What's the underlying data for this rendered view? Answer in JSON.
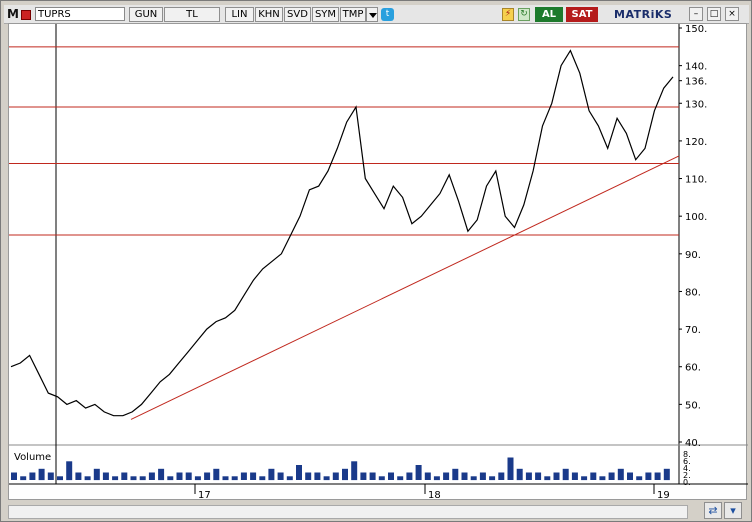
{
  "toolbar": {
    "menu_label": "M",
    "symbol": "TUPRS",
    "buttons": [
      "GUN",
      "TL",
      "LIN",
      "KHN",
      "SVD",
      "SYM",
      "TMP"
    ],
    "buy_label": "AL",
    "sell_label": "SAT",
    "brand": "MATRiKS",
    "window_controls": [
      "–",
      "□",
      "×"
    ]
  },
  "chart": {
    "price_axis_labels": [
      "150.",
      "140.",
      "136.",
      "130.",
      "120.",
      "110.",
      "100.",
      "90.",
      "80.",
      "70.",
      "60.",
      "50.",
      "40."
    ],
    "date_labels": [
      "17",
      "18",
      "19"
    ],
    "volume_label": "Volume",
    "volume_axis_labels": [
      "8.",
      "6.",
      "4.",
      "2.",
      "0."
    ]
  },
  "chart_data": {
    "type": "line",
    "y_range": [
      40,
      150
    ],
    "y_ticks": [
      150,
      140,
      136,
      130,
      120,
      110,
      100,
      90,
      80,
      70,
      60,
      50,
      40
    ],
    "horizontal_levels": [
      145,
      129,
      114,
      95
    ],
    "trendline": {
      "from": [
        0,
        46
      ],
      "to": [
        1,
        116
      ]
    },
    "price_series": [
      60,
      61,
      63,
      58,
      53,
      52,
      50,
      51,
      49,
      50,
      48,
      47,
      47,
      48,
      50,
      53,
      56,
      58,
      61,
      64,
      67,
      70,
      72,
      73,
      75,
      79,
      83,
      86,
      88,
      90,
      95,
      100,
      107,
      108,
      112,
      118,
      125,
      129,
      110,
      106,
      102,
      108,
      105,
      98,
      100,
      103,
      106,
      111,
      104,
      96,
      99,
      108,
      112,
      100,
      97,
      103,
      112,
      124,
      130,
      140,
      144,
      138,
      128,
      124,
      118,
      126,
      122,
      115,
      118,
      128,
      134,
      137
    ],
    "volume_series": [
      2,
      1,
      2,
      3,
      2,
      1,
      5,
      2,
      1,
      3,
      2,
      1,
      2,
      1,
      1,
      2,
      3,
      1,
      2,
      2,
      1,
      2,
      3,
      1,
      1,
      2,
      2,
      1,
      3,
      2,
      1,
      4,
      2,
      2,
      1,
      2,
      3,
      5,
      2,
      2,
      1,
      2,
      1,
      2,
      4,
      2,
      1,
      2,
      3,
      2,
      1,
      2,
      1,
      2,
      6,
      3,
      2,
      2,
      1,
      2,
      3,
      2,
      1,
      2,
      1,
      2,
      3,
      2,
      1,
      2,
      2,
      3
    ]
  },
  "colors": {
    "price_line": "#000000",
    "levels": "#c0281e",
    "volume": "#1a3a8a",
    "grid": "#000000"
  }
}
